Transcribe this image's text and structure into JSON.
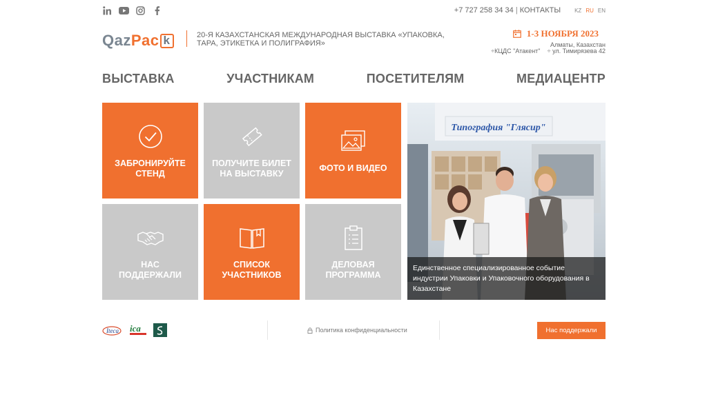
{
  "social": [
    "linkedin-icon",
    "youtube-icon",
    "instagram-icon",
    "facebook-icon"
  ],
  "topbar": {
    "phone": "+7 727 258 34 34",
    "separator": "|",
    "contacts": "КОНТАКТЫ",
    "langs": [
      "KZ",
      "RU",
      "EN"
    ],
    "active_lang": "RU"
  },
  "header": {
    "logo_main": "Qaz",
    "logo_accent": "Pac",
    "logo_box": "k",
    "tagline": "20-я Казахстанская Международная Выставка «Упаковка, Тара, Этикетка и Полиграфия»",
    "date": "1-3 НОЯБРЯ 2023",
    "city": "Алматы, Казахстан",
    "venue": "КЦДС \"Атакент\"",
    "address": "ул. Тимирязева 42"
  },
  "nav": {
    "items": [
      "ВЫСТАВКА",
      "УЧАСТНИКАМ",
      "ПОСЕТИТЕЛЯМ",
      "МЕДИАЦЕНТР"
    ]
  },
  "tiles": [
    {
      "label": "ЗАБРОНИРУЙТЕ СТЕНД",
      "icon": "check-circle-icon",
      "color": "orange"
    },
    {
      "label": "ПОЛУЧИТЕ БИЛЕТ НА ВЫСТАВКУ",
      "icon": "ticket-icon",
      "color": "gray"
    },
    {
      "label": "ФОТО И ВИДЕО",
      "icon": "photos-icon",
      "color": "orange"
    },
    {
      "label": "НАС ПОДДЕРЖАЛИ",
      "icon": "handshake-icon",
      "color": "gray"
    },
    {
      "label": "СПИСОК УЧАСТНИКОВ",
      "icon": "book-icon",
      "color": "orange"
    },
    {
      "label": "ДЕЛОВАЯ ПРОГРАММА",
      "icon": "clipboard-icon",
      "color": "gray"
    }
  ],
  "photo": {
    "sign": "Типография \"Глясир\"",
    "caption": "Единственное специализированное событие индустрии Упаковки и Упаковочного оборудования в Казахстане"
  },
  "footer": {
    "partners": [
      "Iteca",
      "ica"
    ],
    "policy": "Политика конфиденциальности",
    "support_button": "Нас поддержали"
  },
  "colors": {
    "accent": "#f0702f",
    "tile_gray": "#c9c9c9",
    "text": "#666666"
  }
}
